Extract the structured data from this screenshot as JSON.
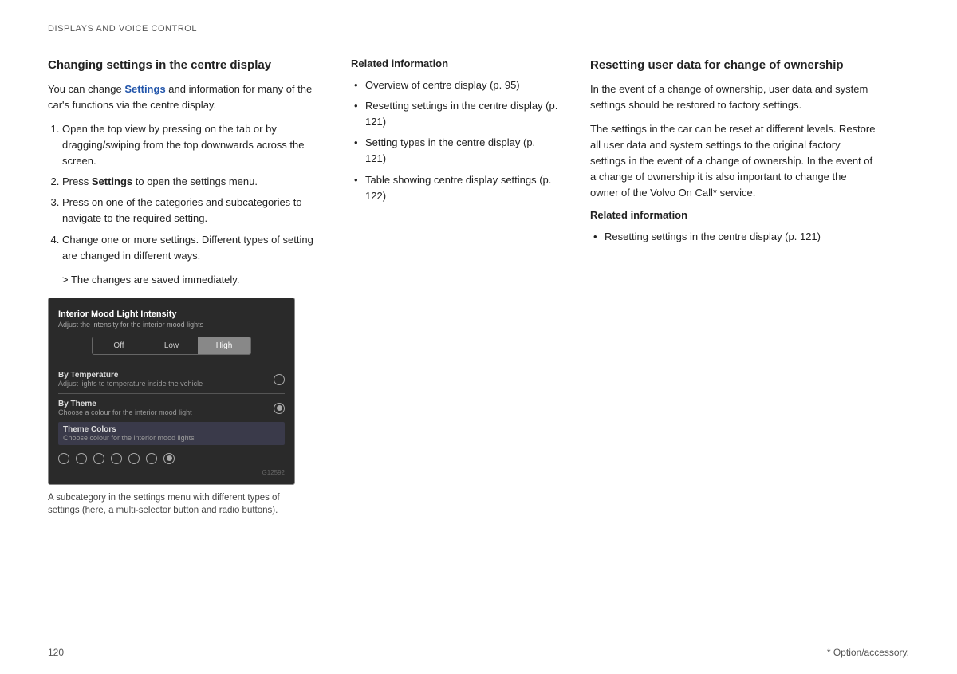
{
  "page": {
    "top_label": "DISPLAYS AND VOICE CONTROL",
    "page_number": "120",
    "footnote": "* Option/accessory."
  },
  "col_left": {
    "heading": "Changing settings in the centre display",
    "intro": "You can change Settings and information for many of the car's functions via the centre display.",
    "steps": [
      "Open the top view by pressing on the tab or by dragging/swiping from the top downwards across the screen.",
      "Press Settings to open the settings menu.",
      "Press on one of the categories and subcategories to navigate to the required setting.",
      "Change one or more settings. Different types of setting are changed in different ways."
    ],
    "arrow_item": "The changes are saved immediately.",
    "screenshot": {
      "title": "Interior Mood Light Intensity",
      "subtitle": "Adjust the intensity for the interior mood lights",
      "buttons": [
        "Off",
        "Low",
        "High"
      ],
      "active_button": "High",
      "rows": [
        {
          "title": "By Temperature",
          "desc": "Adjust lights to temperature inside the vehicle",
          "radio": false
        },
        {
          "title": "By Theme",
          "desc": "Choose a colour for the interior mood light",
          "radio": true
        }
      ],
      "theme_colors_title": "Theme Colors",
      "theme_colors_desc": "Choose colour for the interior mood lights",
      "color_count": 7,
      "selected_color_index": 6,
      "id_label": "G12592"
    },
    "caption": "A subcategory in the settings menu with different types of settings (here, a multi-selector button and radio buttons)."
  },
  "col_mid": {
    "heading": "Related information",
    "links": [
      "Overview of centre display (p. 95)",
      "Resetting settings in the centre display (p. 121)",
      "Setting types in the centre display (p. 121)",
      "Table showing centre display settings (p. 122)"
    ]
  },
  "col_right": {
    "heading": "Resetting user data for change of ownership",
    "para1": "In the event of a change of ownership, user data and system settings should be restored to factory settings.",
    "para2": "The settings in the car can be reset at different levels. Restore all user data and system settings to the original factory settings in the event of a change of ownership. In the event of a change of ownership it is also important to change the owner of the Volvo On Call* service.",
    "related_heading": "Related information",
    "related_links": [
      "Resetting settings in the centre display (p. 121)"
    ]
  }
}
